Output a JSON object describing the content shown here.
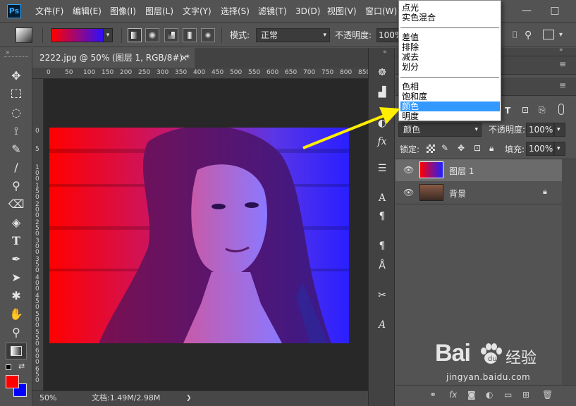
{
  "app": {
    "logo": "Ps"
  },
  "menu": [
    "文件(F)",
    "编辑(E)",
    "图像(I)",
    "图层(L)",
    "文字(Y)",
    "选择(S)",
    "滤镜(T)",
    "3D(D)",
    "视图(V)",
    "窗口(W)"
  ],
  "window_buttons": [
    "—",
    "□"
  ],
  "options_bar": {
    "mode_label": "模式:",
    "mode_value": "正常",
    "opacity_label": "不透明度:",
    "opacity_value": "100%"
  },
  "document": {
    "tab_title": "2222.jpg @ 50% (图层 1, RGB/8#) *",
    "tab_close": "×",
    "ruler_h": [
      "0",
      "50",
      "100",
      "150",
      "200",
      "250",
      "300",
      "350",
      "400",
      "450",
      "500",
      "550",
      "600",
      "650",
      "700",
      "750",
      "800",
      "850"
    ],
    "ruler_v": [
      "0",
      "5",
      "1 0 0",
      "1 5 0",
      "2 0 0",
      "2 5 0",
      "3 0 0",
      "3 5 0",
      "4 0 0",
      "4 5 0",
      "5 0 0",
      "5 5 0",
      "6 0 0",
      "6 5 0",
      "7 0 0"
    ],
    "zoom": "50%",
    "doc_info": "文档:1.49M/2.98M"
  },
  "blend_menu": {
    "items_top": [
      "点光",
      "实色混合"
    ],
    "items_mid": [
      "差值",
      "排除",
      "减去",
      "划分"
    ],
    "items_bottom": [
      "色相",
      "饱和度",
      "颜色",
      "明度"
    ],
    "selected": "颜色"
  },
  "layers_panel": {
    "blend_mode": "颜色",
    "opacity_label": "不透明度:",
    "opacity_value": "100%",
    "lock_label": "锁定:",
    "fill_label": "填充:",
    "fill_value": "100%",
    "layers": [
      {
        "name": "图层 1",
        "selected": true,
        "locked": false
      },
      {
        "name": "背景",
        "selected": false,
        "locked": true
      }
    ]
  },
  "watermark": {
    "brand": "Bai",
    "brand2": "经验",
    "url": "jingyan.baidu.com"
  },
  "colors": {
    "foreground": "#ff0000",
    "background": "#0000ff",
    "highlight": "#3399ff",
    "arrow": "#ffee00"
  }
}
